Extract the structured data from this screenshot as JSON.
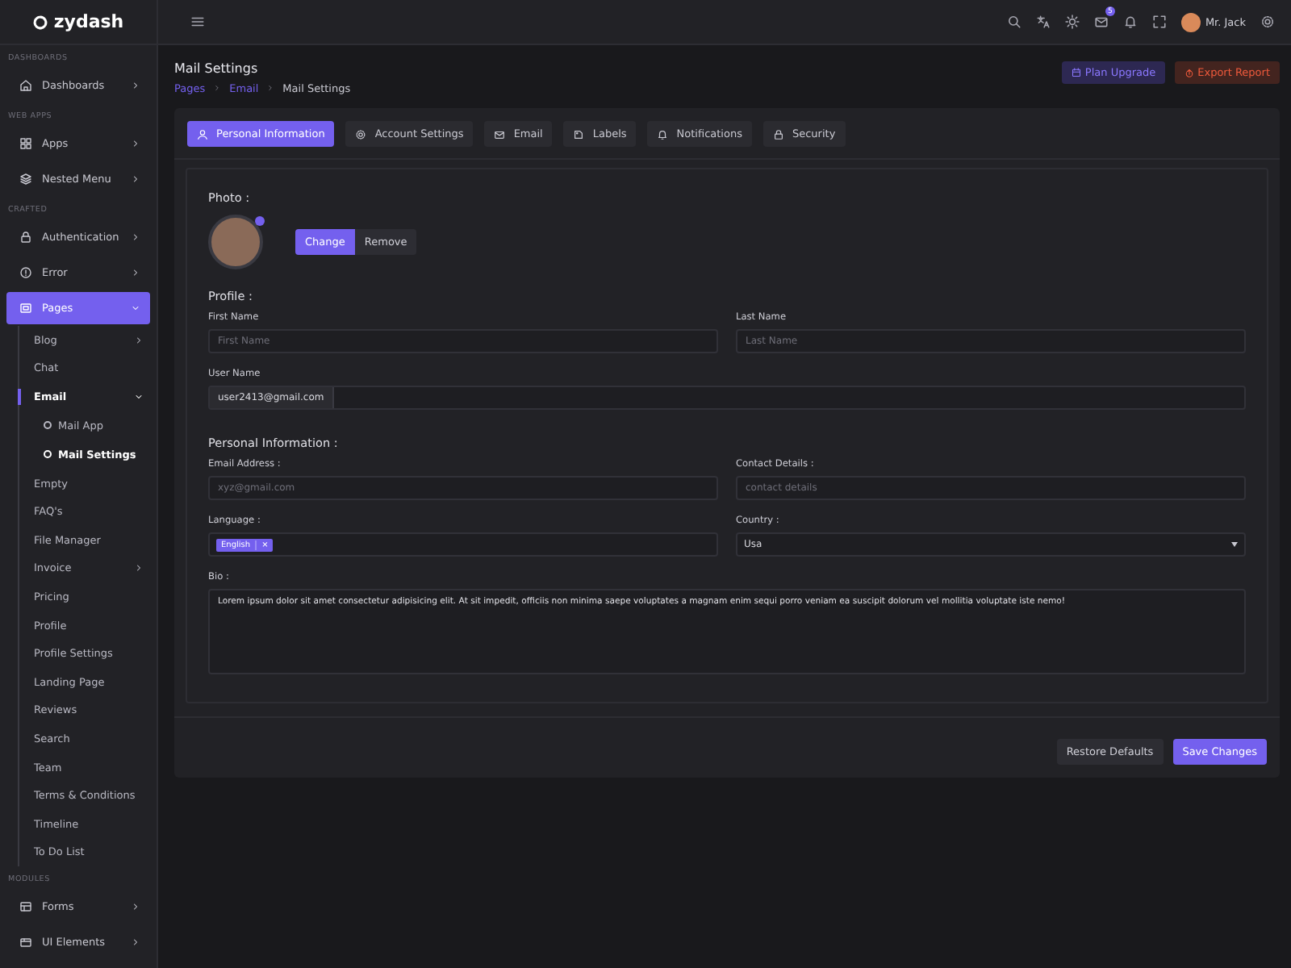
{
  "sidebar": {
    "logo": "zydash",
    "sections": [
      {
        "label": "DASHBOARDS",
        "items": [
          {
            "label": "Dashboards",
            "selected": false,
            "expanded": false
          }
        ]
      },
      {
        "label": "WEB APPS",
        "items": [
          {
            "label": "Apps",
            "selected": false,
            "expanded": false
          },
          {
            "label": "Nested Menu",
            "selected": false,
            "expanded": false
          }
        ]
      },
      {
        "label": "CRAFTED",
        "items": [
          {
            "label": "Authentication",
            "selected": false,
            "expanded": false
          },
          {
            "label": "Error",
            "selected": false,
            "expanded": false
          },
          {
            "label": "Pages",
            "selected": true,
            "expanded": true,
            "children": [
              {
                "label": "Blog",
                "kind": "group",
                "selected": false,
                "expanded": false
              },
              {
                "label": "Chat",
                "kind": "link",
                "selected": false,
                "expanded": false
              },
              {
                "label": "Email",
                "kind": "group",
                "selected": true,
                "expanded": true,
                "children": [
                  {
                    "label": "Mail App",
                    "selected": false
                  },
                  {
                    "label": "Mail Settings",
                    "selected": true
                  }
                ]
              },
              {
                "label": "Empty",
                "kind": "link",
                "selected": false,
                "expanded": false
              },
              {
                "label": "FAQ's",
                "kind": "link",
                "selected": false,
                "expanded": false
              },
              {
                "label": "File Manager",
                "kind": "link",
                "selected": false,
                "expanded": false
              },
              {
                "label": "Invoice",
                "kind": "group",
                "selected": false,
                "expanded": false
              },
              {
                "label": "Pricing",
                "kind": "link",
                "selected": false,
                "expanded": false
              },
              {
                "label": "Profile",
                "kind": "link",
                "selected": false,
                "expanded": false
              },
              {
                "label": "Profile Settings",
                "kind": "link",
                "selected": false,
                "expanded": false
              },
              {
                "label": "Landing Page",
                "kind": "link",
                "selected": false,
                "expanded": false
              },
              {
                "label": "Reviews",
                "kind": "link",
                "selected": false,
                "expanded": false
              },
              {
                "label": "Search",
                "kind": "link",
                "selected": false,
                "expanded": false
              },
              {
                "label": "Team",
                "kind": "link",
                "selected": false,
                "expanded": false
              },
              {
                "label": "Terms & Conditions",
                "kind": "link",
                "selected": false,
                "expanded": false
              },
              {
                "label": "Timeline",
                "kind": "link",
                "selected": false,
                "expanded": false
              },
              {
                "label": "To Do List",
                "kind": "link",
                "selected": false,
                "expanded": false
              }
            ]
          }
        ]
      },
      {
        "label": "MODULES",
        "items": [
          {
            "label": "Forms",
            "selected": false,
            "expanded": false
          },
          {
            "label": "UI Elements",
            "selected": false,
            "expanded": false
          }
        ]
      }
    ]
  },
  "header": {
    "mail_badge": "5",
    "user_name": "Mr. Jack"
  },
  "page": {
    "title": "Mail Settings",
    "breadcrumb": [
      "Pages",
      "Email",
      "Mail Settings"
    ],
    "actions": [
      {
        "label": "Plan Upgrade",
        "kind": "primary"
      },
      {
        "label": "Export Report",
        "kind": "danger"
      }
    ]
  },
  "tabs": [
    {
      "label": "Personal Information",
      "selected": true
    },
    {
      "label": "Account Settings",
      "selected": false
    },
    {
      "label": "Email",
      "selected": false
    },
    {
      "label": "Labels",
      "selected": false
    },
    {
      "label": "Notifications",
      "selected": false
    },
    {
      "label": "Security",
      "selected": false
    }
  ],
  "form": {
    "photo_label": "Photo :",
    "photo_buttons": [
      {
        "label": "Change",
        "kind": "primary"
      },
      {
        "label": "Remove",
        "kind": "secondary"
      }
    ],
    "profile_heading": "Profile :",
    "first_name": {
      "label": "First Name",
      "placeholder": "First Name"
    },
    "last_name": {
      "label": "Last Name",
      "placeholder": "Last Name"
    },
    "user_name": {
      "label": "User Name",
      "value": "user2413@gmail.com"
    },
    "personal_heading": "Personal Information :",
    "email": {
      "label": "Email Address :",
      "placeholder": "xyz@gmail.com"
    },
    "contact": {
      "label": "Contact Details :",
      "placeholder": "contact details"
    },
    "language": {
      "label": "Language :",
      "tags": [
        {
          "label": "English",
          "remove": "×"
        }
      ]
    },
    "country": {
      "label": "Country :",
      "value": "Usa"
    },
    "bio": {
      "label": "Bio :",
      "value": "Lorem ipsum dolor sit amet consectetur adipisicing elit. At sit impedit, officiis non minima saepe voluptates a magnam enim sequi porro veniam ea suscipit dolorum vel mollitia voluptate iste nemo!"
    }
  },
  "footer_buttons": [
    {
      "label": "Restore Defaults",
      "kind": "secondary"
    },
    {
      "label": "Save Changes",
      "kind": "primary"
    }
  ]
}
